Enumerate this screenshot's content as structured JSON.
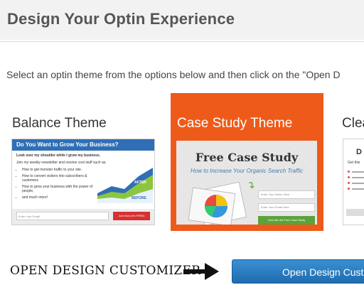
{
  "page": {
    "title": "Design Your Optin Experience",
    "instructions": "Select an optin theme from the options below and then click on the \"Open D"
  },
  "themes": [
    {
      "name": "Balance Theme",
      "selected": false,
      "preview": {
        "headline": "Do You Want to Grow Your Business?",
        "line1": "Look over my shoulder while I grow my business.",
        "line2": "Join my weekly newsletter and receive cool stuff such as:",
        "bullets": [
          "How to get monster traffic to your site.",
          "How to convert visitors into subscribers & customers",
          "How to grow your business with the power of people,",
          "and much more!"
        ],
        "label_after": "AFTER",
        "label_before": "BEFORE",
        "input_placeholder": "Enter Your Email",
        "button": "Join Now (It's FREE)"
      }
    },
    {
      "name": "Case Study Theme",
      "selected": true,
      "preview": {
        "headline": "Free Case Study",
        "subheadline": "How to Increase Your Organic Search Traffic",
        "name_placeholder": "Enter Your Name Here",
        "email_placeholder": "Enter Your Email Here",
        "button": "Give Me the Free Case Study"
      }
    },
    {
      "name": "Clea",
      "selected": false,
      "preview": {
        "headline": "D",
        "list_prefix": "Get this"
      }
    }
  ],
  "footer": {
    "customizer_label": "OPEN DESIGN CUSTOMIZER",
    "button_label": "Open Design Custo"
  },
  "colors": {
    "selected_card": "#ee5a1a",
    "button_blue": "#1f6cb0",
    "balance_header": "#2f6fb6",
    "balance_button": "#d63030",
    "case_button": "#5aa33a"
  }
}
